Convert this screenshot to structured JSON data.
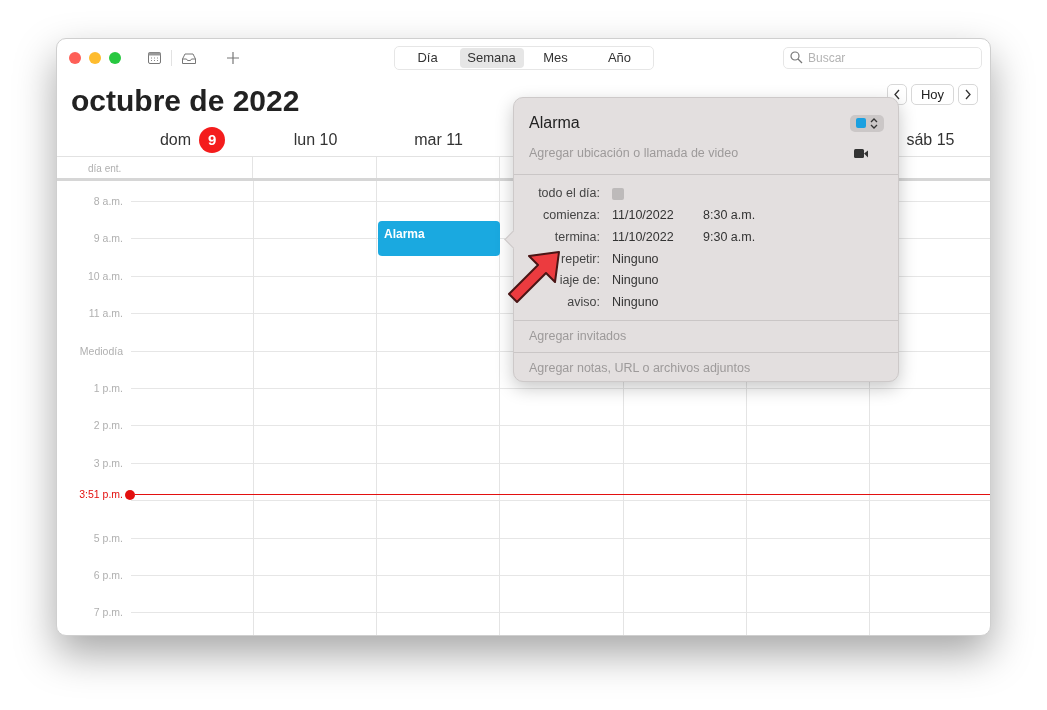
{
  "toolbar": {
    "view_tabs": [
      {
        "label": "Día",
        "selected": false
      },
      {
        "label": "Semana",
        "selected": true
      },
      {
        "label": "Mes",
        "selected": false
      },
      {
        "label": "Año",
        "selected": false
      }
    ],
    "search": {
      "placeholder": "Buscar"
    }
  },
  "header": {
    "title": "octubre de 2022",
    "today_button": "Hoy"
  },
  "days": [
    {
      "name": "dom",
      "number": "9",
      "today": true
    },
    {
      "name": "lun",
      "number": "10",
      "today": false
    },
    {
      "name": "mar",
      "number": "11",
      "today": false
    },
    {
      "name": "sáb",
      "number": "15",
      "today": false
    }
  ],
  "all_day_label": "día ent.",
  "hours": [
    "8 a.m.",
    "9 a.m.",
    "10 a.m.",
    "11 a.m.",
    "Mediodía",
    "1 p.m.",
    "2 p.m.",
    "3 p.m."
  ],
  "now_marker": {
    "time": "3:51 p.m."
  },
  "later_hours": [
    "5 p.m.",
    "6 p.m.",
    "7 p.m."
  ],
  "event": {
    "title": "Alarma"
  },
  "popover": {
    "title": "Alarma",
    "location_placeholder": "Agregar ubicación o llamada de video",
    "fields": [
      {
        "label": "todo el día:",
        "kind": "checkbox",
        "checked": false
      },
      {
        "label": "comienza:",
        "kind": "datetime",
        "date": "11/10/2022",
        "time": "8:30 a.m."
      },
      {
        "label": "termina:",
        "kind": "datetime",
        "date": "11/10/2022",
        "time": "9:30 a.m."
      },
      {
        "label": "repetir:",
        "kind": "text",
        "value": "Ninguno"
      },
      {
        "label": "iaje de:",
        "kind": "text",
        "value": "Ninguno"
      },
      {
        "label": "aviso:",
        "kind": "text",
        "value": "Ninguno"
      }
    ],
    "invitees_placeholder": "Agregar invitados",
    "notes_placeholder": "Agregar notas, URL o archivos adjuntos"
  }
}
